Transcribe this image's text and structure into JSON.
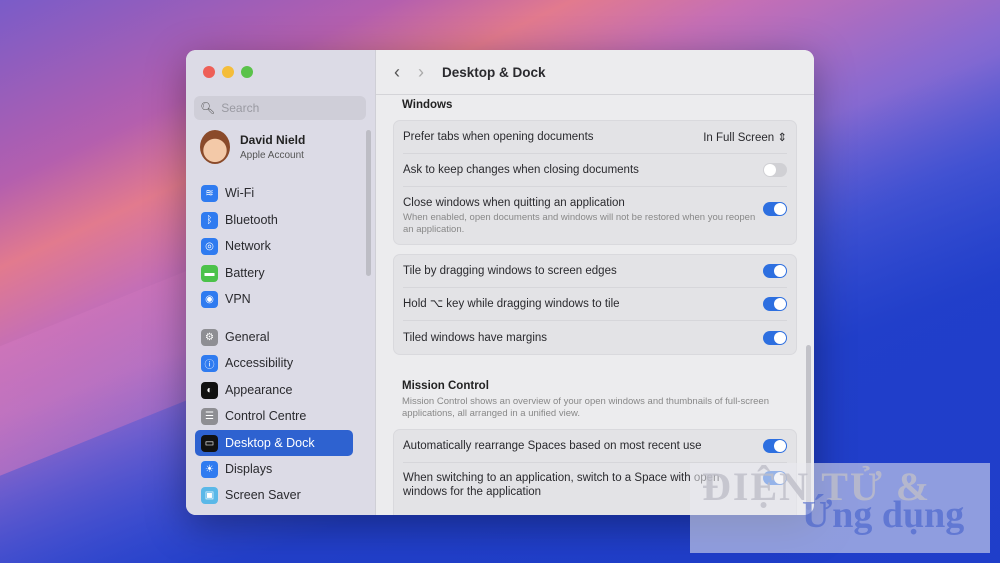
{
  "window": {
    "title": "Desktop & Dock",
    "traffic_lights": [
      "#ee5f57",
      "#f4bd3a",
      "#5ac24a"
    ]
  },
  "sidebar": {
    "search_placeholder": "Search",
    "account": {
      "name": "David Nield",
      "subtitle": "Apple Account"
    },
    "items": [
      {
        "label": "Wi-Fi",
        "icon": "wifi-icon",
        "color": "#2f7bf0",
        "glyph": "≋"
      },
      {
        "label": "Bluetooth",
        "icon": "bluetooth-icon",
        "color": "#2f7bf0",
        "glyph": "ᛒ"
      },
      {
        "label": "Network",
        "icon": "globe-icon",
        "color": "#2f7bf0",
        "glyph": "◎"
      },
      {
        "label": "Battery",
        "icon": "battery-icon",
        "color": "#4cc24a",
        "glyph": "▬"
      },
      {
        "label": "VPN",
        "icon": "vpn-icon",
        "color": "#2f7bf0",
        "glyph": "◉"
      },
      {
        "label": "General",
        "icon": "gear-icon",
        "color": "#8e8e93",
        "glyph": "⚙"
      },
      {
        "label": "Accessibility",
        "icon": "accessibility-icon",
        "color": "#2f7bf0",
        "glyph": "ⓘ"
      },
      {
        "label": "Appearance",
        "icon": "appearance-icon",
        "color": "#111111",
        "glyph": "◐"
      },
      {
        "label": "Control Centre",
        "icon": "control-centre-icon",
        "color": "#8e8e93",
        "glyph": "☰"
      },
      {
        "label": "Desktop & Dock",
        "icon": "dock-icon",
        "color": "#111111",
        "glyph": "▭",
        "selected": true
      },
      {
        "label": "Displays",
        "icon": "sun-icon",
        "color": "#2f7bf0",
        "glyph": "☀"
      },
      {
        "label": "Screen Saver",
        "icon": "screensaver-icon",
        "color": "#5ab8e8",
        "glyph": "▣"
      }
    ]
  },
  "main": {
    "windows_title": "Windows",
    "group1": [
      {
        "label": "Prefer tabs when opening documents",
        "value": "In Full Screen"
      },
      {
        "label": "Ask to keep changes when closing documents",
        "on": false
      },
      {
        "label": "Close windows when quitting an application",
        "sub": "When enabled, open documents and windows will not be restored when you reopen an application.",
        "on": true
      }
    ],
    "group2": [
      {
        "label": "Tile by dragging windows to screen edges",
        "on": true
      },
      {
        "label": "Hold ⌥ key while dragging windows to tile",
        "on": true
      },
      {
        "label": "Tiled windows have margins",
        "on": true
      }
    ],
    "mission_title": "Mission Control",
    "mission_desc": "Mission Control shows an overview of your open windows and thumbnails of full-screen applications, all arranged in a unified view.",
    "group3": [
      {
        "label": "Automatically rearrange Spaces based on most recent use",
        "on": true
      },
      {
        "label": "When switching to an application, switch to a Space with open windows for the application",
        "on": true
      }
    ]
  },
  "watermark": {
    "line1": "ĐIỆN TỬ &",
    "line2": "Ứng dụng"
  }
}
